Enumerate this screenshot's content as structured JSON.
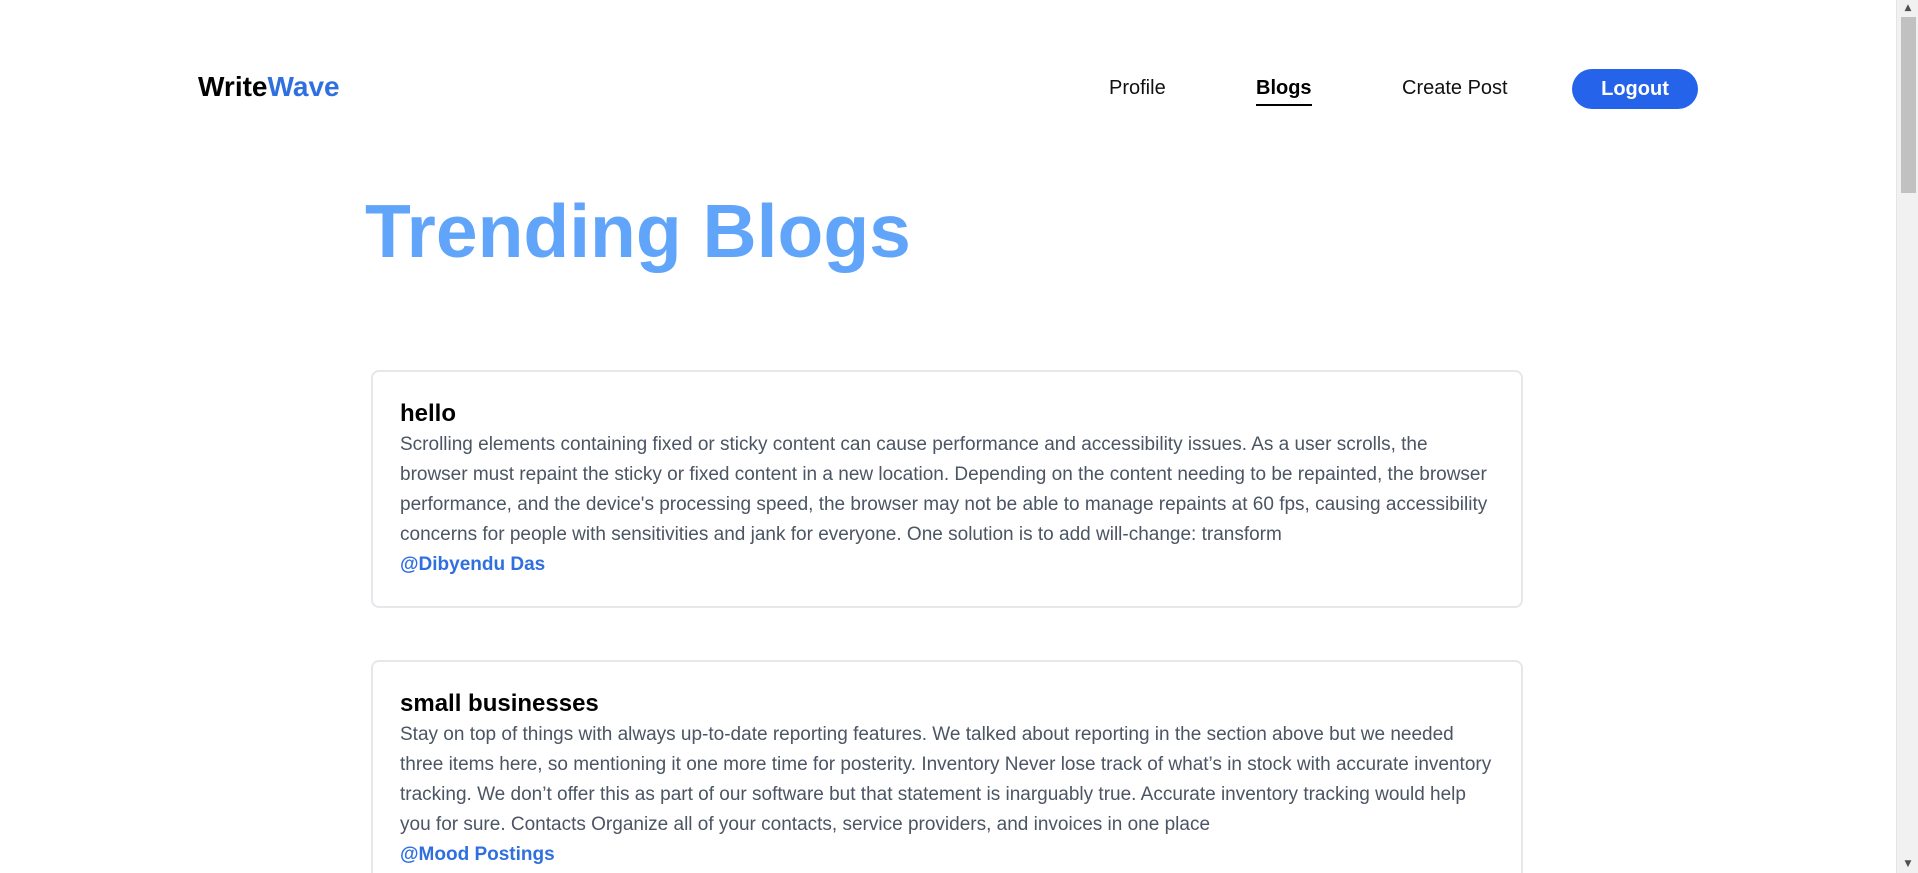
{
  "brand": {
    "part1": "Write",
    "part2": "Wave"
  },
  "nav": {
    "profile": "Profile",
    "blogs": "Blogs",
    "create_post": "Create Post",
    "logout": "Logout"
  },
  "main": {
    "title": "Trending Blogs"
  },
  "posts": [
    {
      "title": "hello",
      "excerpt": "Scrolling elements containing fixed or sticky content can cause performance and accessibility issues. As a user scrolls, the browser must repaint the sticky or fixed content in a new location. Depending on the content needing to be repainted, the browser performance, and the device's processing speed, the browser may not be able to manage repaints at 60 fps, causing accessibility concerns for people with sensitivities and jank for everyone. One solution is to add will-change: transform",
      "author": "@Dibyendu Das"
    },
    {
      "title": "small businesses",
      "excerpt": "Stay on top of things with always up-to-date reporting features. We talked about reporting in the section above but we needed three items here, so mentioning it one more time for posterity. Inventory Never lose track of what’s in stock with accurate inventory tracking. We don’t offer this as part of our software but that statement is inarguably true. Accurate inventory tracking would help you for sure. Contacts Organize all of your contacts, service providers, and invoices in one place",
      "author": "@Mood Postings"
    }
  ],
  "colors": {
    "accent": "#2563eb",
    "brand_accent": "#2f6fe0",
    "title": "#60a5fa",
    "excerpt": "#4b5563"
  },
  "icons": {
    "scroll_up": "triangle-up-icon",
    "scroll_down": "triangle-down-icon"
  }
}
